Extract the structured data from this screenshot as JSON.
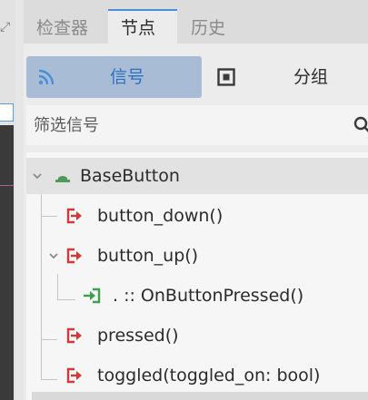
{
  "tabs": [
    {
      "label": "检查器"
    },
    {
      "label": "节点"
    },
    {
      "label": "历史"
    }
  ],
  "mode": {
    "signals_label": "信号",
    "groups_label": "分组"
  },
  "filter": {
    "placeholder": "筛选信号",
    "value": ""
  },
  "tree": {
    "root": "BaseButton",
    "items": [
      {
        "label": "button_down()"
      },
      {
        "label": "button_up()"
      },
      {
        "label": ". :: OnButtonPressed()"
      },
      {
        "label": "pressed()"
      },
      {
        "label": "toggled(toggled_on: bool)"
      }
    ]
  },
  "colors": {
    "accent": "#4a8fd6",
    "signal_icon": "#d23a3a",
    "connection_icon": "#3ea04a",
    "node_icon": "#4f9a5a",
    "selected_mode_bg": "#a9bcd6"
  }
}
